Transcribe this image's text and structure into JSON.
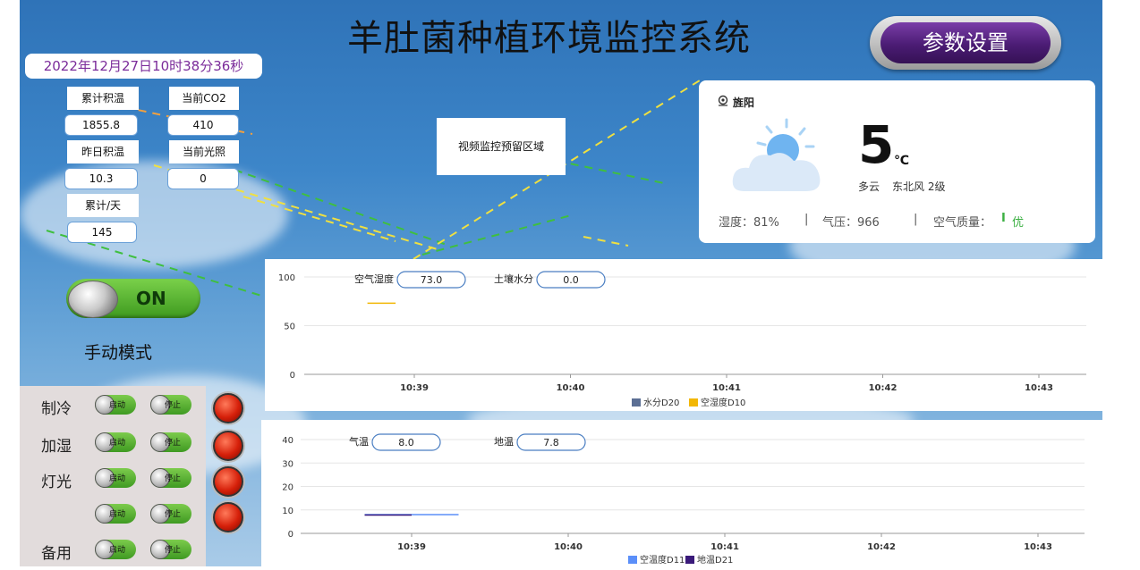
{
  "title": "羊肚菌种植环境监控系统",
  "param_button": "参数设置",
  "datetime": "2022年12月27日10时38分36秒",
  "stats": {
    "acc_temp_label": "累计积温",
    "acc_temp_value": "1855.8",
    "co2_label": "当前CO2",
    "co2_value": "410",
    "yesterday_temp_label": "昨日积温",
    "yesterday_temp_value": "10.3",
    "light_label": "当前光照",
    "light_value": "0",
    "per_day_label": "累计/天",
    "per_day_value": "145"
  },
  "video_placeholder": "视频监控预留区域",
  "weather": {
    "city": "旌阳",
    "temp": "5",
    "unit": "℃",
    "desc": "多云",
    "wind": "东北风 2级",
    "humidity": "湿度：81%",
    "sep1": "|",
    "pressure": "气压：966",
    "sep2": "|",
    "aqi_label": "空气质量：",
    "aqi_bar": "I",
    "aqi_value": "优",
    "aqi_color": "#3cb043"
  },
  "switch": {
    "label": "ON",
    "mode": "手动模式"
  },
  "controls": {
    "rows": [
      {
        "label": "制冷",
        "start": "启动",
        "stop": "停止"
      },
      {
        "label": "加湿",
        "start": "启动",
        "stop": "停止"
      },
      {
        "label": "灯光",
        "start": "启动",
        "stop": "停止"
      },
      {
        "label": "",
        "start": "启动",
        "stop": "停止"
      },
      {
        "label": "备用",
        "start": "启动",
        "stop": "停止"
      }
    ]
  },
  "chart_data": [
    {
      "type": "line",
      "readouts": [
        {
          "label": "空气湿度",
          "value": "73.0"
        },
        {
          "label": "土壤水分",
          "value": "0.0"
        }
      ],
      "x": [
        "10:39",
        "10:40",
        "10:41",
        "10:42",
        "10:43"
      ],
      "ylim": [
        0,
        100
      ],
      "yticks": [
        "0",
        "50",
        "100"
      ],
      "series": [
        {
          "name": "水分D20",
          "color": "#5b6f94",
          "points": []
        },
        {
          "name": "空湿度D10",
          "color": "#f2b705",
          "points": [
            [
              10.645,
              73
            ],
            [
              10.648,
              73
            ]
          ]
        }
      ]
    },
    {
      "type": "line",
      "readouts": [
        {
          "label": "气温",
          "value": "8.0"
        },
        {
          "label": "地温",
          "value": "7.8"
        }
      ],
      "x": [
        "10:39",
        "10:40",
        "10:41",
        "10:42",
        "10:43"
      ],
      "ylim": [
        0,
        40
      ],
      "yticks": [
        "0",
        "10",
        "20",
        "30",
        "40"
      ],
      "series": [
        {
          "name": "空温度D11",
          "color": "#5b8ff9",
          "points": [
            [
              10.645,
              8.0
            ],
            [
              10.655,
              8.0
            ]
          ]
        },
        {
          "name": "地温D21",
          "color": "#3a1a7a",
          "points": [
            [
              10.645,
              7.8
            ],
            [
              10.65,
              7.8
            ]
          ]
        }
      ]
    }
  ]
}
